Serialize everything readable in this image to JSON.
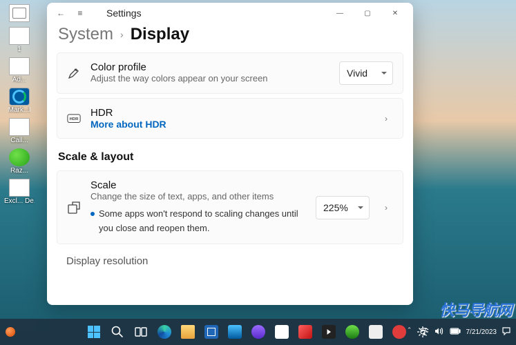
{
  "watermark": "快马导航网",
  "desktop": {
    "items": [
      {
        "label": "",
        "name": "recycle-bin"
      },
      {
        "label": "1",
        "name": "file-1"
      },
      {
        "label": "Ad...",
        "name": "file-ad"
      },
      {
        "label": "Mark...l",
        "name": "file-mark"
      },
      {
        "label": "Call...",
        "name": "file-call"
      },
      {
        "label": "Raz...",
        "name": "app-razer"
      },
      {
        "label": "Excl... De...",
        "name": "file-excl"
      }
    ]
  },
  "window": {
    "app_name": "Settings",
    "breadcrumb_root": "System",
    "breadcrumb_current": "Display",
    "color_profile": {
      "title": "Color profile",
      "desc": "Adjust the way colors appear on your screen",
      "value": "Vivid"
    },
    "hdr": {
      "title": "HDR",
      "link": "More about HDR"
    },
    "section_scale": "Scale & layout",
    "scale": {
      "title": "Scale",
      "desc": "Change the size of text, apps, and other items",
      "hint": "Some apps won't respond to scaling changes until you close and reopen them.",
      "value": "225%"
    },
    "resolution_cut": "Display resolution"
  },
  "taskbar": {
    "date": "7/21/2023"
  }
}
